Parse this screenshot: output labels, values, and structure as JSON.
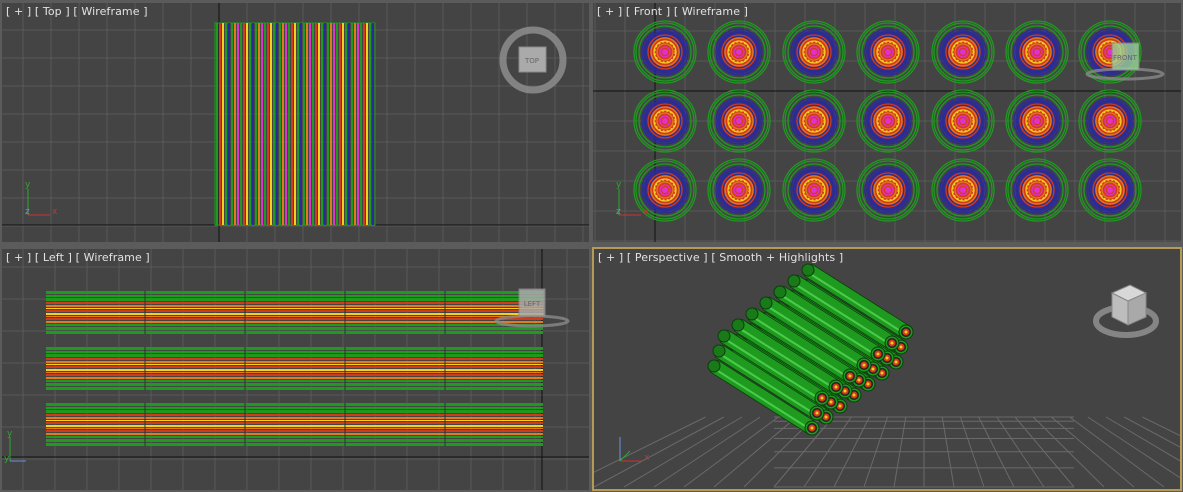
{
  "viewports": {
    "top": {
      "menu": "[ + ]",
      "view": "[ Top ]",
      "shading": "[ Wireframe ]",
      "viewcube_label": "TOP"
    },
    "front": {
      "menu": "[ + ]",
      "view": "[ Front ]",
      "shading": "[ Wireframe ]",
      "viewcube_label": "FRONT"
    },
    "left": {
      "menu": "[ + ]",
      "view": "[ Left ]",
      "shading": "[ Wireframe ]",
      "viewcube_label": "LEFT"
    },
    "perspective": {
      "menu": "[ + ]",
      "view": "[ Perspective ]",
      "shading": "[ Smooth + Highlights ]"
    }
  },
  "axis_tripod": {
    "x": "x",
    "y": "y",
    "z": "z"
  },
  "colors": {
    "viewport_bg": "#444444",
    "grid": "#595959",
    "active_border": "#b39b55",
    "cable_outer": "#1e9a1e",
    "cable_red": "#d23a1c",
    "cable_yellow": "#f0d020",
    "cable_orange": "#e27a22",
    "cable_blue": "#2a2a9a",
    "cable_magenta": "#e030d0"
  },
  "scene": {
    "rows": 3,
    "columns": 7
  }
}
